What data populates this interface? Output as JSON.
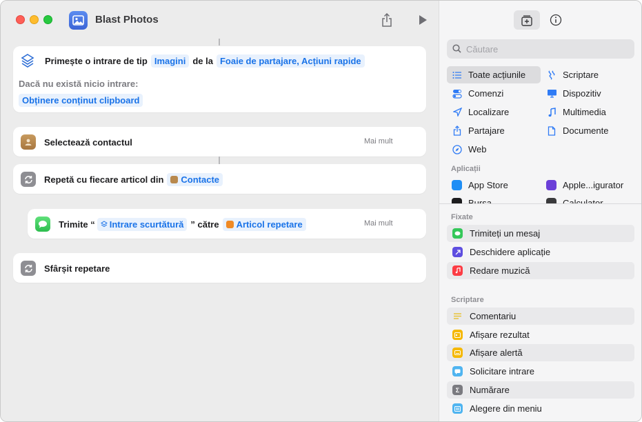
{
  "window": {
    "title": "Blast Photos"
  },
  "editor": {
    "receive": {
      "label": "Primește o intrare de tip",
      "type_token": "Imagini",
      "from_label": "de la",
      "source_token": "Foaie de partajare, Acțiuni rapide",
      "no_input_label": "Dacă nu există nicio intrare:",
      "fallback_token": "Obținere conținut clipboard"
    },
    "select_contact": {
      "label": "Selectează contactul",
      "more": "Mai mult"
    },
    "repeat": {
      "label": "Repetă cu fiecare articol din",
      "token": "Contacte"
    },
    "send": {
      "label_start": "Trimite “",
      "input_token": "Intrare scurtătură",
      "label_mid": "” către",
      "item_token": "Articol repetare",
      "more": "Mai mult"
    },
    "end_repeat": {
      "label": "Sfârșit repetare"
    }
  },
  "panel": {
    "search_placeholder": "Căutare",
    "categories": [
      {
        "label": "Toate acțiunile",
        "icon": "list-icon"
      },
      {
        "label": "Scriptare",
        "icon": "scripting-icon"
      },
      {
        "label": "Comenzi",
        "icon": "toggle-icon"
      },
      {
        "label": "Dispozitiv",
        "icon": "display-icon"
      },
      {
        "label": "Localizare",
        "icon": "location-icon"
      },
      {
        "label": "Multimedia",
        "icon": "music-note-icon"
      },
      {
        "label": "Partajare",
        "icon": "share-icon"
      },
      {
        "label": "Documente",
        "icon": "document-icon"
      },
      {
        "label": "Web",
        "icon": "compass-icon"
      }
    ],
    "apps_header": "Aplicații",
    "apps": [
      {
        "label": "App Store",
        "color": "#1f8ef5"
      },
      {
        "label": "Apple...igurator",
        "color": "#6b3fd8"
      },
      {
        "label": "Bursa",
        "color": "#1c1c1e"
      },
      {
        "label": "Calculator",
        "color": "#3a3a3c"
      }
    ],
    "pinned_header": "Fixate",
    "pinned": [
      {
        "label": "Trimiteți un mesaj",
        "color": "#34c759"
      },
      {
        "label": "Deschidere aplicație",
        "color": "#5e4ee0"
      },
      {
        "label": "Redare muzică",
        "color": "#fc3c44"
      }
    ],
    "scripting_header": "Scriptare",
    "scripting": [
      {
        "label": "Comentariu",
        "color": "#f2d048"
      },
      {
        "label": "Afișare rezultat",
        "color": "#f5b800"
      },
      {
        "label": "Afișare alertă",
        "color": "#f5b800"
      },
      {
        "label": "Solicitare intrare",
        "color": "#4fb4f0"
      },
      {
        "label": "Numărare",
        "color": "#7a7a80"
      },
      {
        "label": "Alegere din meniu",
        "color": "#4fb4f0"
      }
    ]
  }
}
